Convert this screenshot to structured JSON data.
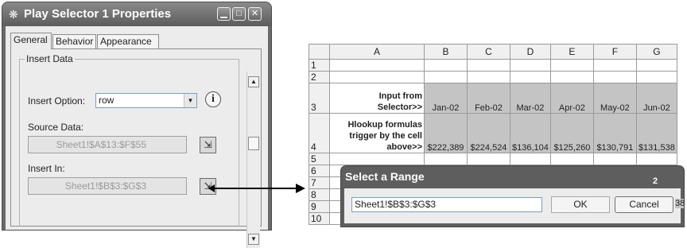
{
  "props_window": {
    "title": "Play Selector 1 Properties",
    "tabs": [
      "General",
      "Behavior",
      "Appearance"
    ],
    "group_title": "Insert Data",
    "insert_option_label": "Insert Option:",
    "insert_option_value": "row",
    "source_data_label": "Source Data:",
    "source_data_value": "Sheet1!$A$13:$F$55",
    "insert_in_label": "Insert In:",
    "insert_in_value": "Sheet1!$B$3:$G$3"
  },
  "sheet": {
    "columns": [
      "A",
      "B",
      "C",
      "D",
      "E",
      "F",
      "G"
    ],
    "row_numbers": [
      "1",
      "2",
      "3",
      "4",
      "5",
      "6",
      "7",
      "8",
      "9",
      "10"
    ],
    "row3_label": [
      "Input from",
      "Selector>>"
    ],
    "row3_values": [
      "Jan-02",
      "Feb-02",
      "Mar-02",
      "Apr-02",
      "May-02",
      "Jun-02"
    ],
    "row4_label": [
      "Hlookup formulas",
      "trigger by the cell",
      "above>>"
    ],
    "row4_values": [
      "$222,389",
      "$224,524",
      "$136,104",
      "$125,260",
      "$130,791",
      "$131,538"
    ]
  },
  "range_dialog": {
    "title": "Select a Range",
    "input_value": "Sheet1!$B$3:$G$3",
    "ok_label": "OK",
    "cancel_label": "Cancel",
    "peek_a": "2",
    "peek_b": "38"
  }
}
